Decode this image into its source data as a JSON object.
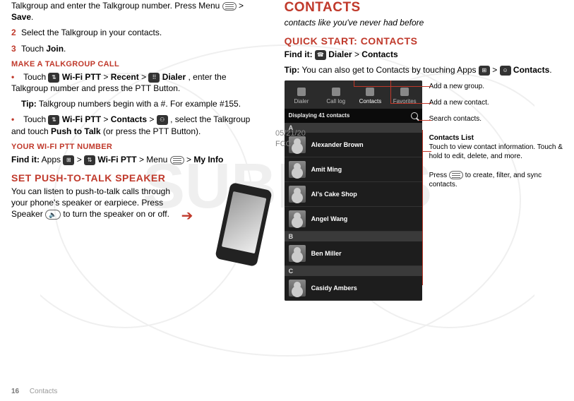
{
  "left": {
    "intro_line": "Talkgroup and enter the Talkgroup number. Press Menu ",
    "intro_line2": " > ",
    "save": "Save",
    "intro_end": ".",
    "step2": "Select the Talkgroup in your contacts.",
    "step3_prefix": "Touch ",
    "step3_join": "Join",
    "step3_end": ".",
    "make_heading": "MAKE A TALKGROUP CALL",
    "bullet1_a": "Touch ",
    "wifi_ptt": "Wi-Fi PTT",
    "bullet1_b": " > ",
    "recent": "Recent",
    "bullet1_c": " > ",
    "dialer": " Dialer",
    "bullet1_d": ", enter the Talkgroup number and press the PTT Button.",
    "tip_label": "Tip:",
    "tip1": " Talkgroup numbers begin with a #. For example #155.",
    "bullet2_a": "Touch ",
    "bullet2_b": " > ",
    "contacts_bold": "Contacts",
    "bullet2_c": " > ",
    "bullet2_d": ", select the Talkgroup and touch ",
    "push_to_talk": "Push to Talk",
    "bullet2_e": " (or press the PTT Button).",
    "your_number": "YOUR WI-FI PTT NUMBER",
    "findit": "Find it:",
    "findit_a": " Apps ",
    "findit_b": " > ",
    "findit_c": " > Menu ",
    "findit_d": " > ",
    "my_info": "My Info",
    "set_speaker": "SET PUSH-TO-TALK SPEAKER",
    "speaker_text_a": "You can listen to push-to-talk calls through your phone's speaker or earpiece. Press Speaker ",
    "speaker_text_b": " to turn the speaker on or off."
  },
  "right": {
    "title": "CONTACTS",
    "subtitle": "contacts like you've never had before",
    "quick_start": "QUICK START: CONTACTS",
    "findit": "Find it:",
    "findit_dialer": " Dialer",
    "findit_gt": " > ",
    "findit_contacts": "Contacts",
    "tip_label": "Tip:",
    "tip_text_a": " You can also get to Contacts by touching Apps ",
    "tip_text_b": " > ",
    "tip_contacts": " Contacts",
    "tip_end": ".",
    "tabs": {
      "dialer": "Dialer",
      "calllog": "Call log",
      "contacts": "Contacts",
      "favorites": "Favorites"
    },
    "displaying": "Displaying 41 contacts",
    "letters": {
      "a": "A",
      "b": "B",
      "c": "C"
    },
    "rows": {
      "r1": "Alexander Brown",
      "r2": "Amit Ming",
      "r3": "Al's Cake Shop",
      "r4": "Angel Wang",
      "r5": "Ben Miller",
      "r6": "Casidy Ambers"
    },
    "ann1": "Add a new group.",
    "ann2": "Add a new contact.",
    "ann3": "Search contacts.",
    "ann4_title": "Contacts  List",
    "ann4_body": "Touch to view contact information. Touch & hold to edit, delete, and more.",
    "ann5_a": "Press ",
    "ann5_b": " to create, filter, and sync contacts."
  },
  "fcc": {
    "line1": "05/21/20",
    "line2": "FCC"
  },
  "footer": {
    "page": "16",
    "section": "Contacts"
  }
}
